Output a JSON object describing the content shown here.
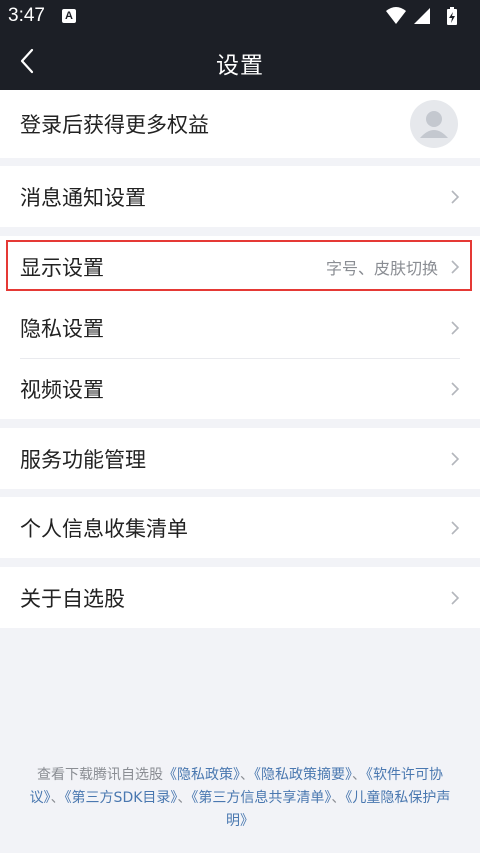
{
  "status_bar": {
    "time": "3:47",
    "notification_badge": "A",
    "icons": [
      "wifi-icon",
      "signal-icon",
      "battery-charging-icon"
    ]
  },
  "header": {
    "title": "设置",
    "back_icon": "chevron-left-icon"
  },
  "login": {
    "label": "登录后获得更多权益",
    "avatar_icon": "user-silhouette-icon"
  },
  "settings": {
    "notification": {
      "label": "消息通知设置"
    },
    "display": {
      "label": "显示设置",
      "hint": "字号、皮肤切换"
    },
    "privacy": {
      "label": "隐私设置"
    },
    "video": {
      "label": "视频设置"
    },
    "services": {
      "label": "服务功能管理"
    },
    "personal_info": {
      "label": "个人信息收集清单"
    },
    "about": {
      "label": "关于自选股"
    }
  },
  "footer": {
    "prefix": "查看下载腾讯自选股",
    "sep": "、",
    "links": [
      "《隐私政策》",
      "《隐私政策摘要》",
      "《软件许可协议》",
      "《第三方SDK目录》",
      "《第三方信息共享清单》",
      "《儿童隐私保护声明》"
    ]
  },
  "colors": {
    "header_bg": "#1c1f26",
    "page_bg": "#f2f3f7",
    "highlight_border": "#e53935",
    "link": "#4a78b0"
  }
}
